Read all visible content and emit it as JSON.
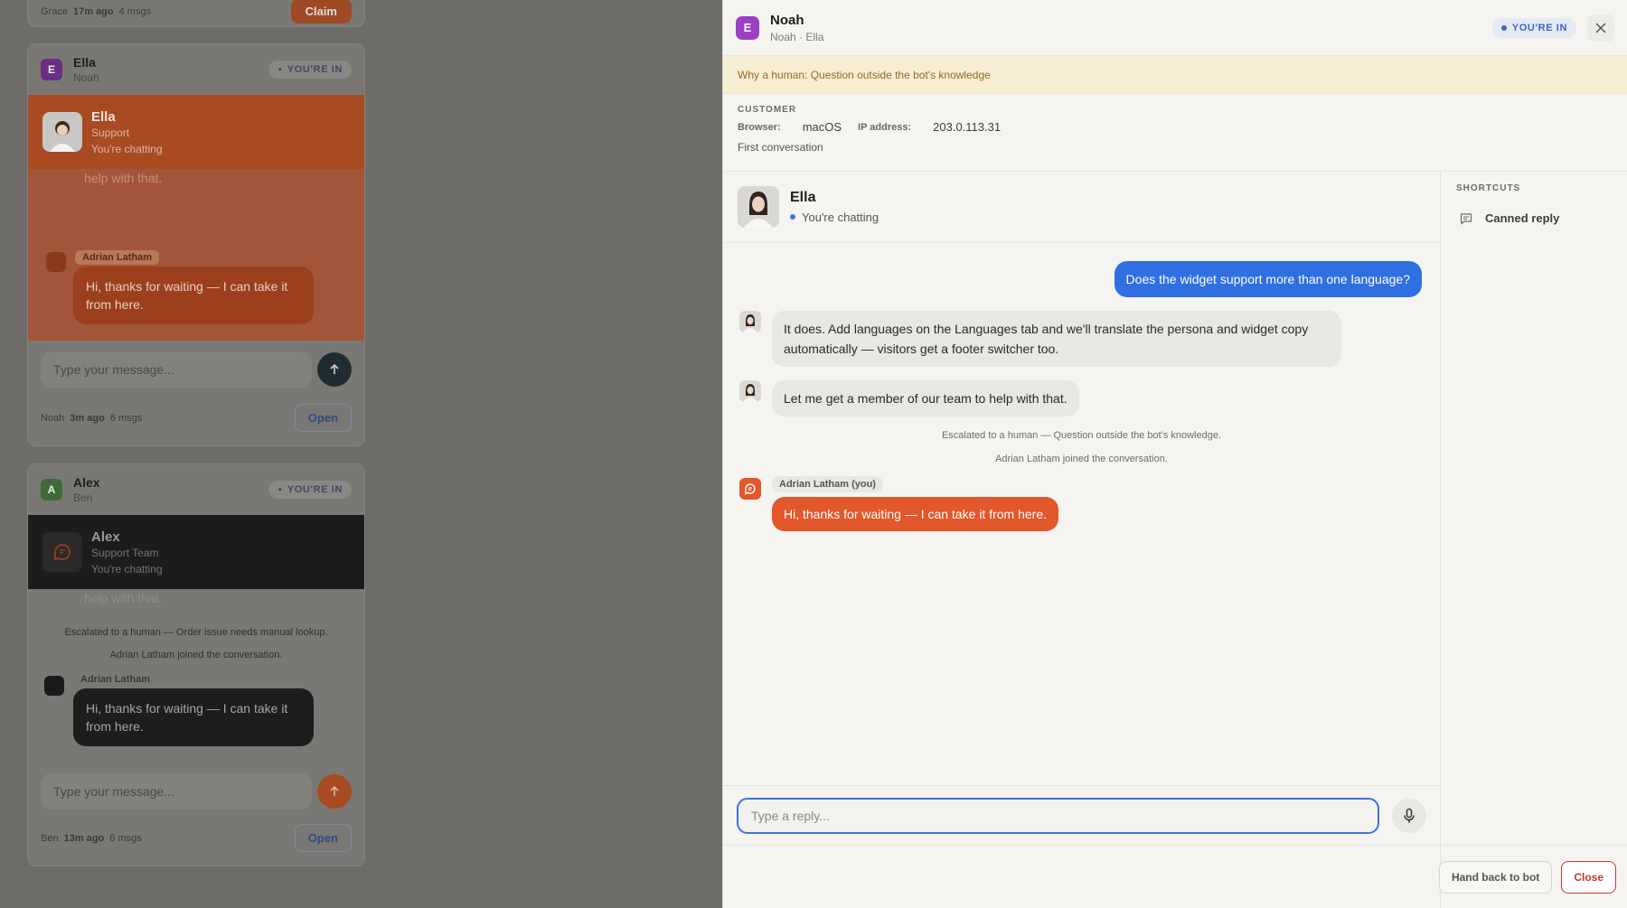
{
  "bg": {
    "top_card": {
      "agent": "Grace",
      "time": "17m ago",
      "msgs": "4 msgs",
      "action": "Claim"
    },
    "ella_card": {
      "avatar_letter": "E",
      "name": "Ella",
      "sub": "Noah",
      "badge": "YOU'RE IN",
      "persona_name": "Ella",
      "persona_role": "Support",
      "persona_status": "You're chatting",
      "faded_text": "help with that.",
      "agent_tag": "Adrian Latham",
      "agent_msg": "Hi, thanks for waiting — I can take it from here.",
      "input_placeholder": "Type your message...",
      "footer_name": "Noah",
      "footer_time": "3m ago",
      "footer_msgs": "6 msgs",
      "open": "Open"
    },
    "alex_card": {
      "avatar_letter": "A",
      "name": "Alex",
      "sub": "Ben",
      "badge": "YOU'RE IN",
      "persona_name": "Alex",
      "persona_role": "Support Team",
      "persona_status": "You're chatting",
      "faded_text": "help with that.",
      "sys1": "Escalated to a human — Order issue needs manual lookup.",
      "sys2": "Adrian Latham joined the conversation.",
      "agent_tag": "Adrian Latham",
      "agent_msg": "Hi, thanks for waiting — I can take it from here.",
      "input_placeholder": "Type your message...",
      "footer_name": "Ben",
      "footer_time": "13m ago",
      "footer_msgs": "6 msgs",
      "open": "Open"
    }
  },
  "panel": {
    "avatar_letter": "E",
    "title": "Noah",
    "subtitle": "Noah · Ella",
    "badge": "YOU'RE IN",
    "banner": "Why a human: Question outside the bot's knowledge",
    "customer": {
      "heading": "CUSTOMER",
      "browser_label": "Browser:",
      "browser_value": "macOS",
      "ip_label": "IP address:",
      "ip_value": "203.0.113.31",
      "note": "First conversation"
    },
    "persona": {
      "name": "Ella",
      "status": "You're chatting"
    },
    "messages": {
      "user": "Does the widget support more than one language?",
      "bot1": "It does. Add languages on the Languages tab and we'll translate the persona and widget copy automatically — visitors get a footer switcher too.",
      "bot2": "Let me get a member of our team to help with that.",
      "sys1": "Escalated to a human — Question outside the bot's knowledge.",
      "sys2": "Adrian Latham joined the conversation.",
      "agent_tag": "Adrian Latham (you)",
      "agent": "Hi, thanks for waiting — I can take it from here."
    },
    "reply_placeholder": "Type a reply...",
    "shortcuts": {
      "heading": "SHORTCUTS",
      "canned": "Canned reply"
    },
    "hand_back": "Hand back to bot",
    "close": "Close"
  },
  "colors": {
    "accent_blue": "#2f6fe2",
    "agent_orange": "#e2572c",
    "close_red": "#c0392b",
    "banner": "#f7edd3"
  }
}
